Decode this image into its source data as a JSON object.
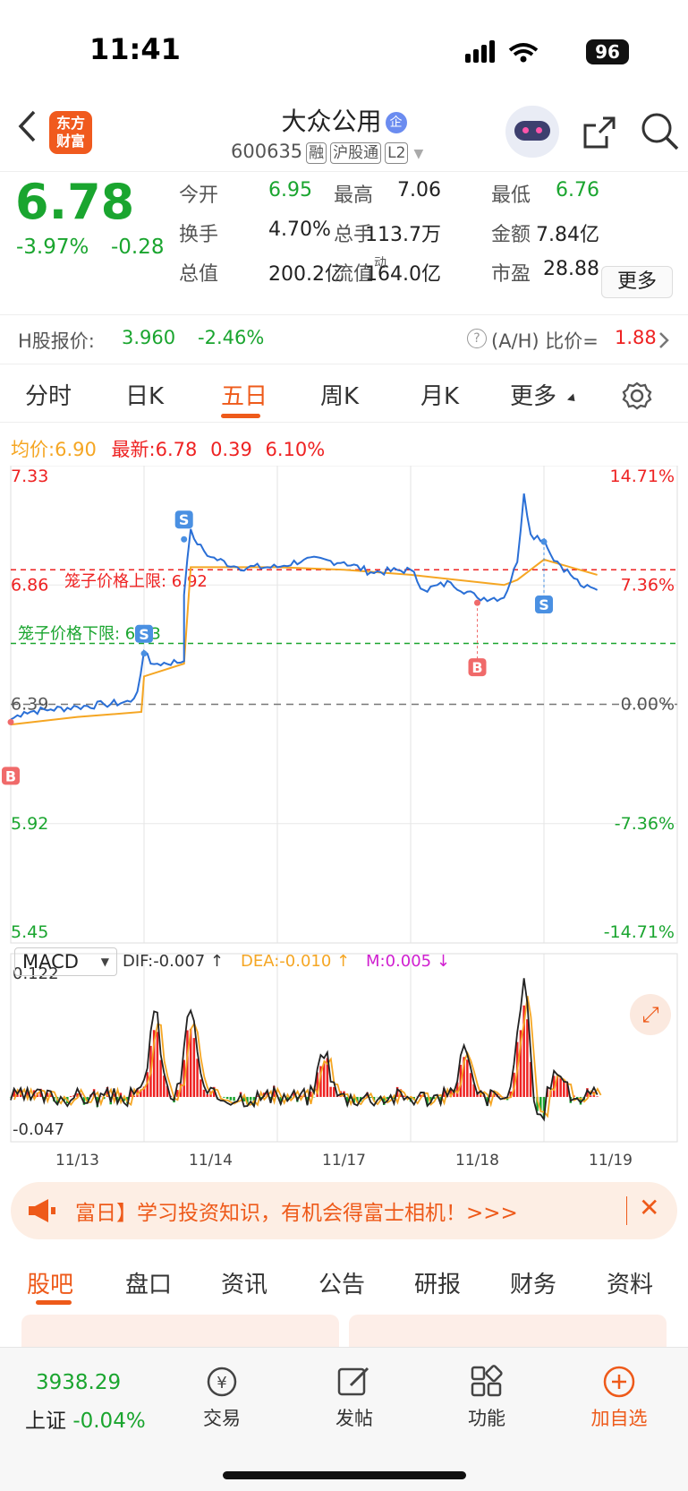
{
  "status": {
    "time": "11:41",
    "battery": "96"
  },
  "header": {
    "logo": "东方\n财富",
    "name": "大众公用",
    "badge": "企",
    "code": "600635",
    "tags": [
      "融",
      "沪股通",
      "L2"
    ]
  },
  "quote": {
    "price": "6.78",
    "pct": "-3.97%",
    "chg": "-0.28",
    "f": [
      [
        "今开",
        "6.95"
      ],
      [
        "最高",
        "7.06"
      ],
      [
        "最低",
        "6.76"
      ],
      [
        "换手",
        "4.70%"
      ],
      [
        "总手",
        "113.7万"
      ],
      [
        "金额",
        "7.84亿"
      ],
      [
        "总值",
        "200.2亿"
      ],
      [
        "流值",
        "164.0亿"
      ],
      [
        "市盈",
        "28.88"
      ]
    ],
    "pe_sup": "动",
    "more": "更多"
  },
  "h": {
    "label": "H股报价:",
    "price": "3.960",
    "pct": "-2.46%",
    "ratio_label": "(A/H) 比价=",
    "ratio": "1.88"
  },
  "tabs": [
    "分时",
    "日K",
    "五日",
    "周K",
    "月K",
    "更多"
  ],
  "legend": {
    "avg_label": "均价:",
    "avg": "6.90",
    "last_label": "最新:",
    "last": "6.78",
    "chg": "0.39",
    "pct": "6.10%"
  },
  "chart_data": [
    {
      "type": "line",
      "title": "",
      "y_ticks": [
        "7.33",
        "6.86",
        "6.39",
        "5.92",
        "5.45"
      ],
      "pct_ticks": [
        "14.71%",
        "7.36%",
        "0.00%",
        "-7.36%",
        "-14.71%"
      ],
      "ylim": [
        5.45,
        7.33
      ],
      "ref": 6.39,
      "dates": [
        "11/13",
        "11/14",
        "11/17",
        "11/18",
        "11/19"
      ],
      "upper_label": "笼子价格上限:",
      "upper": "6.92",
      "lower_label": "笼子价格下限:",
      "lower": "6.63",
      "markers": [
        {
          "t": "S",
          "x": 1.0,
          "y": 6.59
        },
        {
          "t": "S",
          "x": 1.3,
          "y": 7.04
        },
        {
          "t": "B",
          "x": 0.0,
          "y": 6.32
        },
        {
          "t": "B",
          "x": 3.5,
          "y": 6.79
        },
        {
          "t": "S",
          "x": 4.0,
          "y": 7.03
        }
      ],
      "price": [
        [
          0,
          6.33
        ],
        [
          0.1,
          6.36
        ],
        [
          0.3,
          6.37
        ],
        [
          0.5,
          6.38
        ],
        [
          0.7,
          6.39
        ],
        [
          0.9,
          6.4
        ],
        [
          0.95,
          6.44
        ],
        [
          1.0,
          6.6
        ],
        [
          1.05,
          6.55
        ],
        [
          1.1,
          6.55
        ],
        [
          1.3,
          6.56
        ],
        [
          1.3,
          6.82
        ],
        [
          1.35,
          7.08
        ],
        [
          1.4,
          7.02
        ],
        [
          1.5,
          6.97
        ],
        [
          1.7,
          6.93
        ],
        [
          2.0,
          6.93
        ],
        [
          2.2,
          6.96
        ],
        [
          2.5,
          6.95
        ],
        [
          2.7,
          6.91
        ],
        [
          3.0,
          6.92
        ],
        [
          3.1,
          6.84
        ],
        [
          3.3,
          6.87
        ],
        [
          3.5,
          6.81
        ],
        [
          3.7,
          6.81
        ],
        [
          3.8,
          6.95
        ],
        [
          3.85,
          7.22
        ],
        [
          3.9,
          7.06
        ],
        [
          4.0,
          7.04
        ],
        [
          4.05,
          6.98
        ],
        [
          4.2,
          6.9
        ],
        [
          4.3,
          6.85
        ],
        [
          4.4,
          6.84
        ]
      ],
      "avg": [
        [
          0,
          6.31
        ],
        [
          0.5,
          6.34
        ],
        [
          0.98,
          6.36
        ],
        [
          1.0,
          6.5
        ],
        [
          1.3,
          6.55
        ],
        [
          1.35,
          6.93
        ],
        [
          2.0,
          6.93
        ],
        [
          2.5,
          6.92
        ],
        [
          3.0,
          6.9
        ],
        [
          3.7,
          6.86
        ],
        [
          3.8,
          6.88
        ],
        [
          4.0,
          6.96
        ],
        [
          4.2,
          6.93
        ],
        [
          4.4,
          6.9
        ]
      ]
    },
    {
      "type": "line",
      "title": "",
      "indicator": "MACD",
      "dif": "DIF:-0.007 ↑",
      "dea": "DEA:-0.010 ↑",
      "m": "M:0.005 ↓",
      "ylim": [
        -0.047,
        0.122
      ],
      "y_ticks": [
        "0.122",
        "-0.047"
      ]
    }
  ],
  "colors": {
    "accent": "#ee5a1a",
    "up": "#e22",
    "down": "#1aa52f",
    "line": "#2a6fd6",
    "avg": "#f5a623"
  },
  "banner": {
    "text": "富日】学习投资知识，有机会得富士相机！>>>"
  },
  "btabs": [
    "股吧",
    "盘口",
    "资讯",
    "公告",
    "研报",
    "财务",
    "资料"
  ],
  "bottom": {
    "index": "3938.29",
    "index_name": "上证",
    "index_pct": "-0.04%",
    "items": [
      "交易",
      "发帖",
      "功能",
      "加自选"
    ]
  }
}
